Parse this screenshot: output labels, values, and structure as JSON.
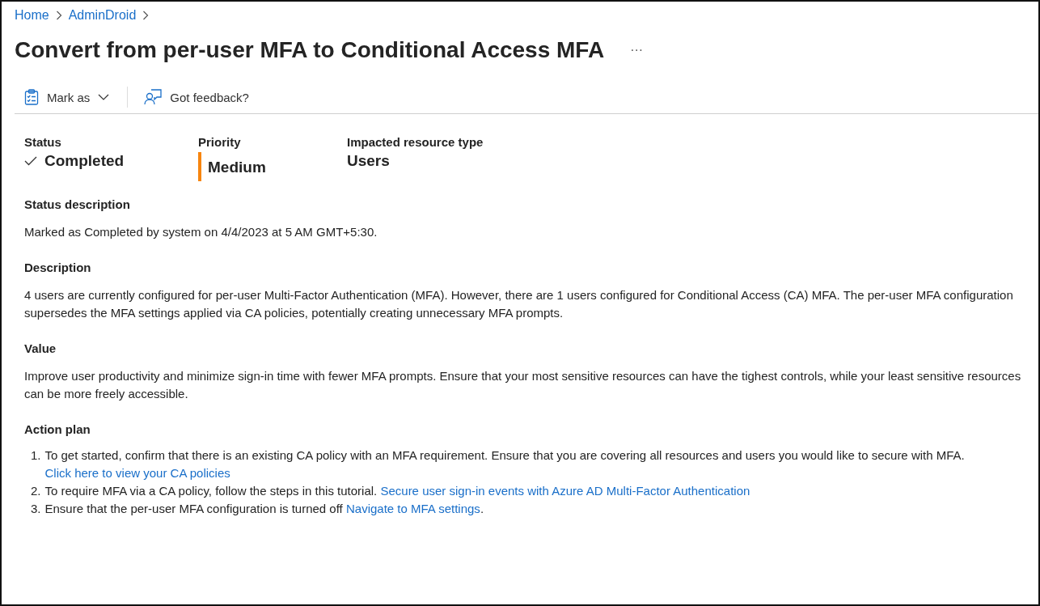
{
  "breadcrumb": [
    "Home",
    "AdminDroid"
  ],
  "title": "Convert from per-user MFA to Conditional Access MFA",
  "more": "···",
  "toolbar": [
    {
      "kind": "mark",
      "label": "Mark as"
    },
    {
      "kind": "feedback",
      "label": "Got feedback?"
    }
  ],
  "fields": [
    {
      "kind": "status",
      "label": "Status",
      "value": "Completed"
    },
    {
      "kind": "priority",
      "label": "Priority",
      "value": "Medium"
    },
    {
      "kind": "plain",
      "label": "Impacted resource type",
      "value": "Users"
    }
  ],
  "sections": [
    {
      "heading": "Status description",
      "text": "Marked as Completed by system on 4/4/2023 at 5 AM GMT+5:30."
    },
    {
      "heading": "Description",
      "text": "4 users are currently configured for per-user Multi-Factor Authentication (MFA). However, there are 1 users configured for Conditional Access (CA) MFA. The per-user MFA configuration supersedes the MFA settings applied via CA policies, potentially creating unnecessary MFA prompts."
    },
    {
      "heading": "Value",
      "text": "Improve user productivity and minimize sign-in time with fewer MFA prompts. Ensure that your most sensitive resources can have the tighest controls, while your least sensitive resources can be more freely accessible."
    }
  ],
  "action_plan": {
    "heading": "Action plan",
    "steps": [
      {
        "number": "1.",
        "text": "To get started, confirm that there is an existing CA policy with an MFA requirement. Ensure that you are covering all resources and users you would like to secure with MFA.",
        "link": "Click here to view your CA policies"
      },
      {
        "number": "2.",
        "text": "To require MFA via a CA policy, follow the steps in this tutorial.",
        "link": "Secure user sign-in events with Azure AD Multi-Factor Authentication"
      },
      {
        "number": "3.",
        "text": "Ensure that the per-user MFA configuration is turned off",
        "link": "Navigate to MFA settings",
        "after": "."
      }
    ]
  }
}
